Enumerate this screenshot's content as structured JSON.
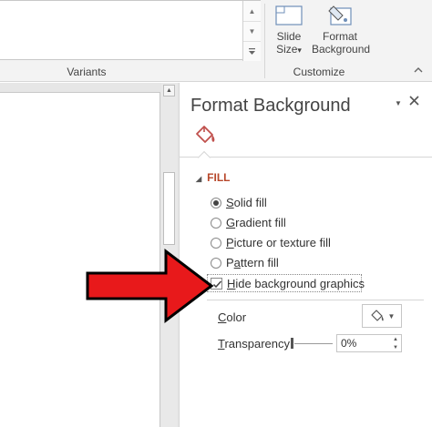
{
  "ribbon": {
    "variants_label": "Variants",
    "customize_label": "Customize",
    "slide_size": {
      "line1": "Slide",
      "line2": "Size",
      "caret": "▾"
    },
    "format_background": {
      "line1": "Format",
      "line2": "Background"
    }
  },
  "pane": {
    "title": "Format Background",
    "section": "FILL",
    "options": {
      "solid_fill": {
        "mnemonic": "S",
        "rest": "olid fill",
        "selected": true
      },
      "gradient_fill": {
        "mnemonic": "G",
        "rest": "radient fill",
        "selected": false
      },
      "picture_fill": {
        "mnemonic": "P",
        "rest": "icture or texture fill",
        "selected": false
      },
      "pattern_fill": {
        "pre": "P",
        "mnemonic": "a",
        "rest": "ttern fill",
        "selected": false
      },
      "hide_background": {
        "mnemonic": "H",
        "rest": "ide background graphics",
        "checked": true
      }
    },
    "color": {
      "mnemonic": "C",
      "rest": "olor"
    },
    "transparency": {
      "mnemonic": "T",
      "rest": "ransparency",
      "value": "0%"
    }
  },
  "colors": {
    "accent": "#b7472a",
    "arrow": "#e8191b"
  }
}
